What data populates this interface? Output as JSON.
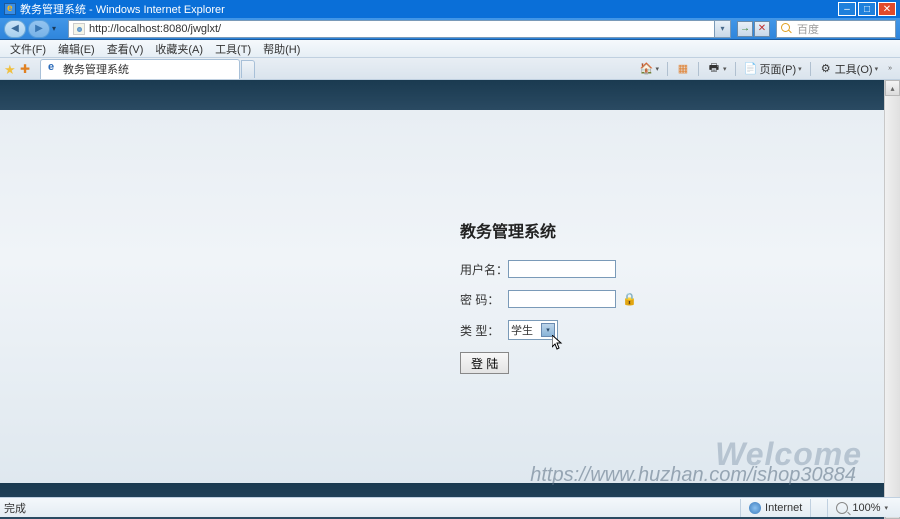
{
  "title": "教务管理系统 - Windows Internet Explorer",
  "url": "http://localhost:8080/jwglxt/",
  "nav": {
    "go": "→",
    "refresh": "↻",
    "stop": "✕"
  },
  "search_placeholder": "百度",
  "menu": {
    "file": "文件(F)",
    "edit": "编辑(E)",
    "view": "查看(V)",
    "favorites": "收藏夹(A)",
    "tools": "工具(T)",
    "help": "帮助(H)"
  },
  "tab": {
    "title": "教务管理系统"
  },
  "toolbar": {
    "page": "页面(P)",
    "tools": "工具(O)"
  },
  "login": {
    "heading": "教务管理系统",
    "user_label": "用户名：",
    "user_value": "",
    "pass_label": "密 码：",
    "pass_value": "",
    "type_label": "类 型：",
    "type_value": "学生",
    "submit": "登 陆"
  },
  "watermark": {
    "welcome": "Welcome",
    "url": "https://www.huzhan.com/ishop30884"
  },
  "status": {
    "done": "完成",
    "zone": "Internet",
    "zoom": "100%"
  }
}
